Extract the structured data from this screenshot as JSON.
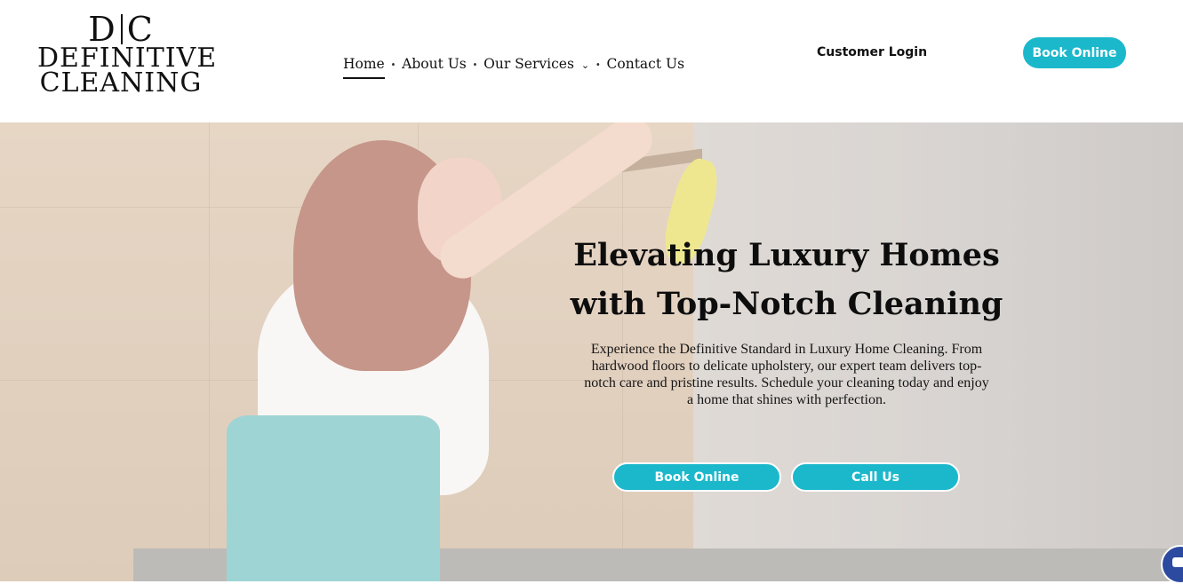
{
  "logo": {
    "mono_left": "D",
    "mono_right": "C",
    "line1": "DEFINITIVE",
    "line2": "CLEANING"
  },
  "nav": {
    "items": [
      {
        "label": "Home",
        "active": true
      },
      {
        "label": "About Us"
      },
      {
        "label": "Our Services",
        "has_dropdown": true
      },
      {
        "label": "Contact Us"
      }
    ],
    "separator": "·"
  },
  "header": {
    "login_label": "Customer Login",
    "book_label": "Book Online"
  },
  "hero": {
    "title_line1": "Elevating Luxury Homes",
    "title_line2": "with Top-Notch Cleaning",
    "body": "Experience the Definitive Standard in Luxury Home Cleaning. From hardwood floors to delicate upholstery, our expert team delivers top-notch care and pristine results. Schedule your cleaning today and enjoy a home that shines with perfection.",
    "book_button": "Book Online",
    "call_button": "Call Us"
  },
  "colors": {
    "accent": "#1bb8cc",
    "chat": "#2b4aa0"
  },
  "icons": {
    "dropdown": "chevron-down-icon",
    "chat": "chat-icon"
  }
}
